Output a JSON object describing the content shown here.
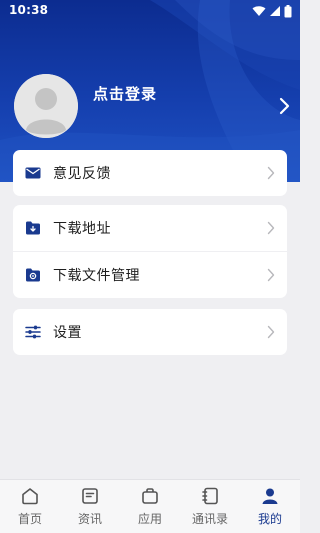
{
  "status_bar": {
    "time": "10:38",
    "icons": [
      "wifi-icon",
      "signal-icon",
      "battery-icon"
    ]
  },
  "profile": {
    "avatar_icon": "default-avatar-icon",
    "login_label": "点击登录",
    "arrow_icon": "chevron-right-icon"
  },
  "menu": {
    "feedback": {
      "label": "意见反馈",
      "icon": "mail-icon"
    },
    "download_address": {
      "label": "下载地址",
      "icon": "folder-download-icon"
    },
    "download_manager": {
      "label": "下载文件管理",
      "icon": "folder-settings-icon"
    },
    "settings": {
      "label": "设置",
      "icon": "sliders-icon"
    }
  },
  "bottom_nav": {
    "items": [
      {
        "label": "首页",
        "icon": "home-icon",
        "active": false
      },
      {
        "label": "资讯",
        "icon": "news-icon",
        "active": false
      },
      {
        "label": "应用",
        "icon": "apps-icon",
        "active": false
      },
      {
        "label": "通讯录",
        "icon": "contacts-icon",
        "active": false
      },
      {
        "label": "我的",
        "icon": "profile-icon",
        "active": true
      }
    ]
  },
  "colors": {
    "header_blue": "#153fae",
    "accent_blue": "#1a3a8f",
    "background": "#efeff2",
    "card": "#ffffff",
    "chevron": "#b8b8bc"
  }
}
